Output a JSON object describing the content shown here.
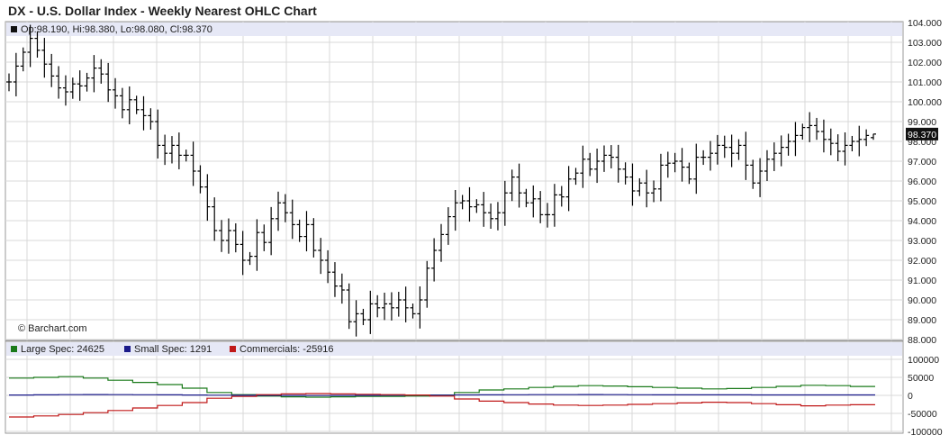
{
  "title": "DX - U.S. Dollar Index - Weekly Nearest OHLC Chart",
  "copyright": "© Barchart.com",
  "ohlc_legend": "Op:98.190, Hi:98.380, Lo:98.080, Cl:98.370",
  "last_price_label": "98.370",
  "cot_legend": [
    {
      "label": "Large Spec: 24625",
      "color": "#1a7a1a"
    },
    {
      "label": "Small Spec: 1291",
      "color": "#1a1a8a"
    },
    {
      "label": "Commercials: -25916",
      "color": "#c01818"
    }
  ],
  "colors": {
    "price": "#000000",
    "large": "#1a7a1a",
    "small": "#1a1a8a",
    "commercials": "#c01818",
    "legend_band": "#e6e8f6",
    "grid": "#d9d9d9"
  },
  "chart_data": [
    {
      "type": "ohlc",
      "title": "DX - U.S. Dollar Index - Weekly Nearest OHLC Chart",
      "ylim": [
        88,
        104
      ],
      "y_ticks": [
        "104.000",
        "103.000",
        "102.000",
        "101.000",
        "100.000",
        "99.000",
        "98.000",
        "97.000",
        "96.000",
        "95.000",
        "94.000",
        "93.000",
        "92.000",
        "91.000",
        "90.000",
        "89.000",
        "88.000"
      ],
      "last_bar": {
        "open": 98.19,
        "high": 98.38,
        "low": 98.08,
        "close": 98.37
      },
      "close": [
        101.0,
        101.8,
        102.5,
        103.2,
        102.6,
        101.9,
        101.3,
        100.7,
        100.5,
        100.9,
        100.8,
        101.2,
        101.7,
        101.4,
        100.6,
        100.3,
        99.6,
        100.1,
        99.6,
        99.3,
        99.0,
        97.8,
        97.4,
        97.8,
        97.3,
        97.3,
        96.5,
        95.7,
        94.7,
        93.5,
        93.0,
        93.5,
        92.8,
        92.0,
        92.2,
        93.4,
        92.9,
        94.1,
        94.9,
        94.4,
        93.8,
        93.2,
        93.8,
        92.5,
        92.0,
        91.4,
        90.7,
        90.5,
        88.9,
        89.3,
        89.0,
        89.8,
        89.6,
        89.8,
        89.6,
        90.0,
        89.6,
        89.3,
        90.0,
        91.6,
        92.5,
        93.3,
        94.2,
        94.9,
        95.0,
        94.7,
        94.8,
        94.4,
        94.1,
        94.4,
        95.4,
        96.2,
        95.4,
        94.9,
        95.1,
        94.3,
        94.3,
        95.3,
        95.2,
        96.1,
        96.4,
        97.1,
        96.6,
        97.0,
        97.3,
        97.2,
        96.6,
        96.2,
        95.5,
        95.9,
        95.4,
        95.6,
        96.8,
        96.9,
        97.0,
        96.7,
        96.1,
        97.2,
        97.2,
        97.4,
        97.8,
        97.7,
        97.4,
        97.8,
        96.8,
        95.9,
        96.5,
        97.1,
        97.4,
        97.7,
        98.0,
        98.3,
        98.7,
        98.8,
        98.5,
        98.1,
        97.9,
        97.5,
        97.8,
        98.0,
        98.1,
        98.3,
        98.37
      ]
    },
    {
      "type": "line",
      "title": "",
      "ylim": [
        -100000,
        100000
      ],
      "y_ticks": [
        "100000",
        "50000",
        "0",
        "-50000",
        "-100000"
      ],
      "series": [
        {
          "name": "Large Spec",
          "values": [
            48000,
            50000,
            52000,
            48000,
            42000,
            36000,
            30000,
            20000,
            8000,
            2000,
            -2000,
            -4000,
            -5000,
            -4000,
            -3000,
            -3000,
            -2000,
            1000,
            8000,
            15000,
            18000,
            22000,
            25000,
            27000,
            26000,
            24000,
            22000,
            20000,
            18000,
            19000,
            22000,
            25000,
            28000,
            27000,
            24625
          ]
        },
        {
          "name": "Small Spec",
          "values": [
            1000,
            1500,
            2000,
            2200,
            2000,
            1800,
            1500,
            1000,
            500,
            200,
            0,
            -200,
            -500,
            -300,
            0,
            300,
            500,
            800,
            1200,
            1500,
            1800,
            2000,
            2100,
            2200,
            2000,
            1800,
            1600,
            1500,
            1400,
            1400,
            1300,
            1300,
            1290,
            1291,
            1291
          ]
        },
        {
          "name": "Commercials",
          "values": [
            -60000,
            -57000,
            -53000,
            -48000,
            -42000,
            -35000,
            -28000,
            -20000,
            -8000,
            -3000,
            2000,
            4000,
            5000,
            4000,
            3000,
            2000,
            1000,
            -2000,
            -10000,
            -16000,
            -20000,
            -24000,
            -27000,
            -28000,
            -27000,
            -25000,
            -23000,
            -21000,
            -19000,
            -20000,
            -23000,
            -26000,
            -29000,
            -27000,
            -25916
          ]
        }
      ]
    }
  ]
}
